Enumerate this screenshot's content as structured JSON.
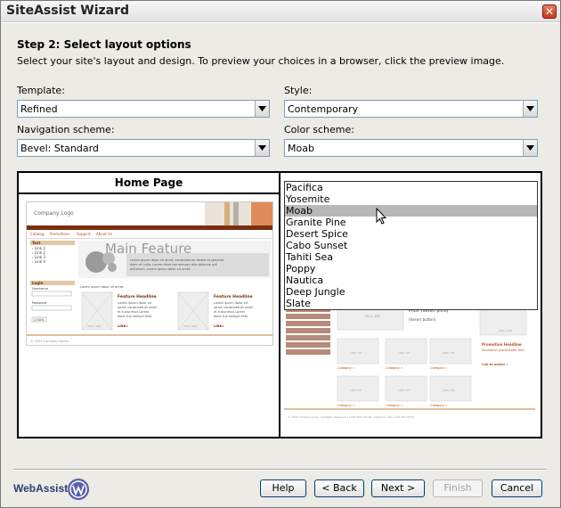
{
  "window": {
    "title": "SiteAssist Wizard",
    "close_glyph": "✕"
  },
  "step": {
    "title": "Step 2: Select layout options",
    "description": "Select your site's layout and design. To preview your choices in a browser, click the preview image."
  },
  "fields": {
    "template": {
      "label": "Template:",
      "value": "Refined"
    },
    "style": {
      "label": "Style:",
      "value": "Contemporary"
    },
    "navigation": {
      "label": "Navigation scheme:",
      "value": "Bevel: Standard"
    },
    "color": {
      "label": "Color scheme:",
      "value": "Moab"
    }
  },
  "color_options": [
    "Pacifica",
    "Yosemite",
    "Moab",
    "Granite Pine",
    "Desert Spice",
    "Cabo Sunset",
    "Tahiti Sea",
    "Poppy",
    "Nautica",
    "Deep Jungle",
    "Slate"
  ],
  "selected_color_index": 2,
  "preview": {
    "left_header": "Home Page",
    "left_thumb": {
      "company": "Company Logo",
      "nav": [
        "Catalog",
        "Promotions",
        "Support",
        "About Us"
      ],
      "sidebar_title": "Text",
      "links": [
        "Link 1",
        "Link 2",
        "Link 3",
        "Link 4"
      ],
      "login_title": "Login",
      "username_label": "Username",
      "password_label": "Password",
      "login_button": "LOGIN",
      "feature_title": "Main Feature",
      "feature_text": "Lorem ipsum dolor sit amet, consectetuer dolore et placerat diam et nulla. Lorem dolor tue semper felis dolorem adl anitonum. Lorem ipsum dolor sit amet.",
      "headline1": "Feature Headline",
      "headline2": "Feature Headline",
      "headline_text": "Lorem ipsum dolor sit amet, consectetuer dolor et a plurimus Lorem dolor tue semper felis dolorem.",
      "link_text": "LINK>",
      "img_size": "150 x 120",
      "copyright": "© 2007 Company Name"
    },
    "right_thumb": {
      "price_label": "Price: [desert price]",
      "basket_label": "[desert button]",
      "img_large": "150 x 100",
      "img_small": "120 x 75",
      "category_link": "Category »",
      "promo_title": "Promotion Headline",
      "promo_text": "Promotion placeholder text.",
      "call_to_action": "Call to action »",
      "footer": "© 2007 Company Logo. All Rights Reserved | 1234 Main Street, Anytown, USA | 123.555.5555"
    }
  },
  "buttons": {
    "help": "Help",
    "back": "< Back",
    "next": "Next >",
    "finish": "Finish",
    "cancel": "Cancel"
  },
  "logo": {
    "text": "WebAssist"
  },
  "colors": {
    "accent_orange": "#b3541e",
    "nav_brown": "#7b2f12",
    "select_gray": "#b8b8b8"
  }
}
